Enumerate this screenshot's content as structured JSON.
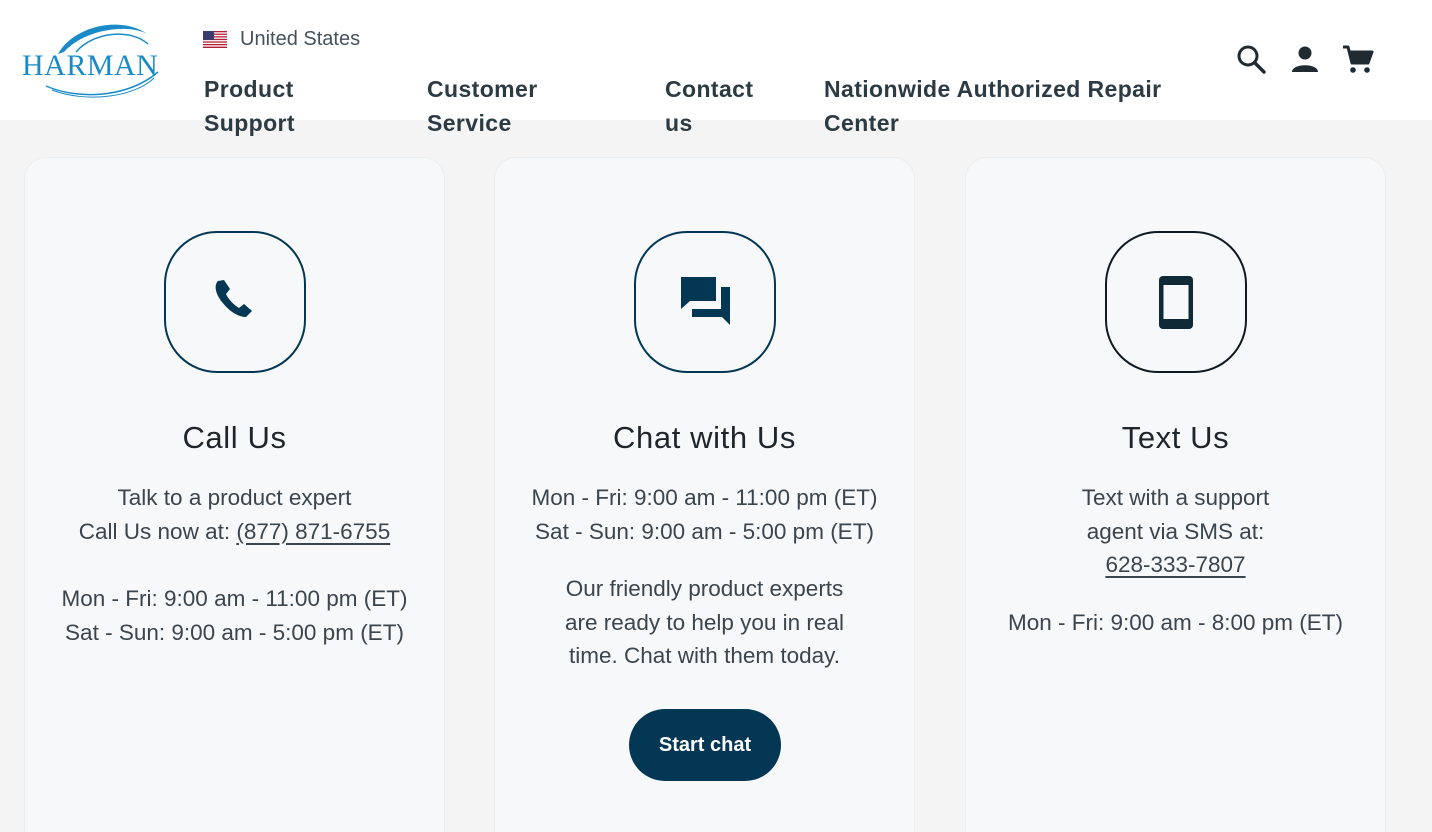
{
  "header": {
    "logo_text": "HARMAN",
    "locale": "United States",
    "nav": [
      {
        "line1": "Product",
        "line2": "Support"
      },
      {
        "line1": "Customer",
        "line2": "Service"
      },
      {
        "line1": "Contact",
        "line2": "us"
      },
      {
        "line1": "Nationwide Authorized Repair",
        "line2": "Center"
      }
    ],
    "icons": [
      "search-icon",
      "account-icon",
      "cart-icon"
    ]
  },
  "cards": [
    {
      "icon": "phone-icon",
      "title": "Call Us",
      "line1": "Talk to a product expert",
      "line2_prefix": "Call Us now at: ",
      "phone": "(877) 871-6755",
      "hours1": "Mon - Fri: 9:00 am - 11:00 pm (ET)",
      "hours2": "Sat - Sun: 9:00 am - 5:00 pm (ET)"
    },
    {
      "icon": "chat-icon",
      "title": "Chat with Us",
      "hours1": "Mon - Fri: 9:00 am - 11:00 pm (ET)",
      "hours2": "Sat - Sun: 9:00 am - 5:00 pm (ET)",
      "desc1": "Our friendly product experts",
      "desc2": "are ready to help you in real",
      "desc3": "time. Chat with them today.",
      "button": "Start chat"
    },
    {
      "icon": "smartphone-icon",
      "title": "Text Us",
      "line1": "Text with a support",
      "line2": "agent via SMS at:",
      "phone": "628-333-7807",
      "hours1": "Mon - Fri: 9:00 am - 8:00 pm (ET)"
    }
  ],
  "colors": {
    "navy": "#033754",
    "brand_blue": "#1a8bc9",
    "background": "#f3f4f3",
    "card": "#f7f8f9"
  }
}
